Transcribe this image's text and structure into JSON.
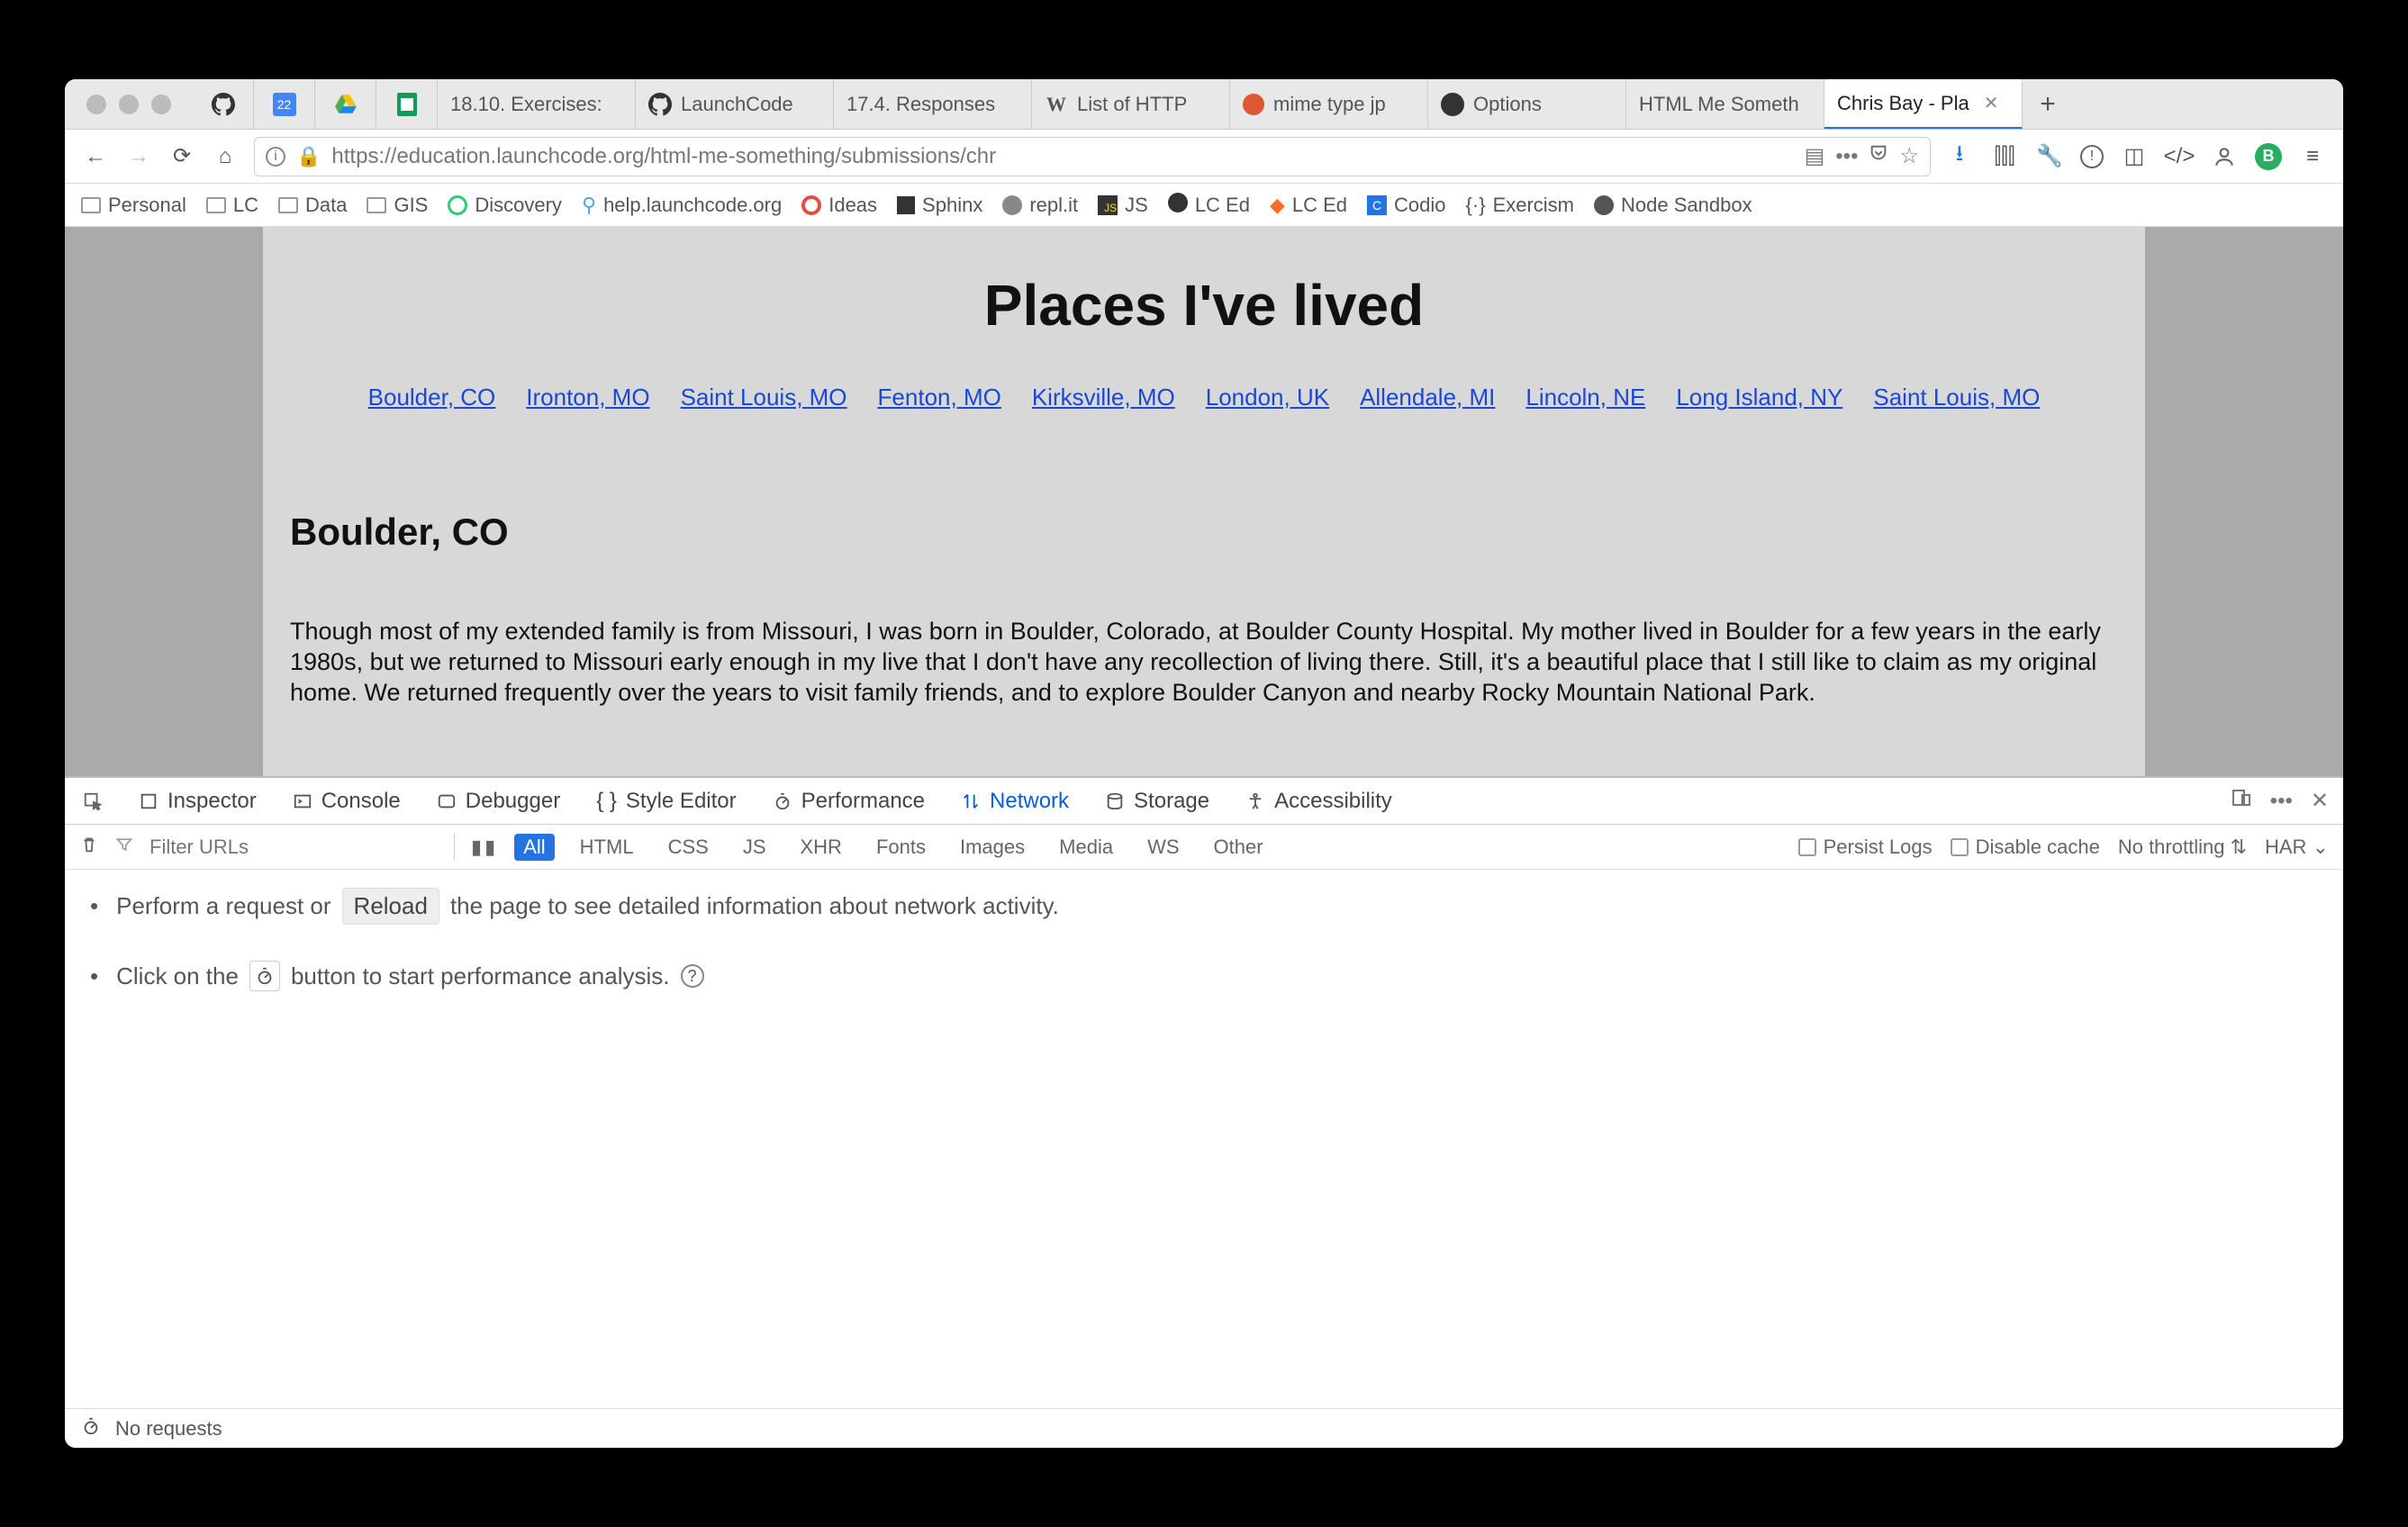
{
  "tabs": [
    {
      "label": "",
      "icon": "github"
    },
    {
      "label": "",
      "icon": "cal22"
    },
    {
      "label": "",
      "icon": "gdrive"
    },
    {
      "label": "",
      "icon": "gsheet"
    },
    {
      "label": "18.10. Exercises:"
    },
    {
      "label": "LaunchCode",
      "icon": "github"
    },
    {
      "label": "17.4. Responses"
    },
    {
      "label": "List of HTTP",
      "icon": "wiki"
    },
    {
      "label": "mime type jp",
      "icon": "ddg"
    },
    {
      "label": "Options",
      "icon": "github"
    },
    {
      "label": "HTML Me Someth"
    },
    {
      "label": "Chris Bay - Pla",
      "active": true
    }
  ],
  "newtab_label": "+",
  "url": "https://education.launchcode.org/html-me-something/submissions/chr",
  "bookmarks": [
    {
      "label": "Personal",
      "type": "folder"
    },
    {
      "label": "LC",
      "type": "folder"
    },
    {
      "label": "Data",
      "type": "folder"
    },
    {
      "label": "GIS",
      "type": "folder"
    },
    {
      "label": "Discovery",
      "icon": "green-circle"
    },
    {
      "label": "help.launchcode.org",
      "icon": "lc-help"
    },
    {
      "label": "Ideas",
      "icon": "red-o"
    },
    {
      "label": "Sphinx",
      "icon": "sphinx"
    },
    {
      "label": "repl.it",
      "icon": "replit"
    },
    {
      "label": "JS",
      "icon": "js"
    },
    {
      "label": "LC Ed",
      "icon": "github"
    },
    {
      "label": "LC Ed",
      "icon": "gitlab"
    },
    {
      "label": "Codio",
      "icon": "codio"
    },
    {
      "label": "Exercism",
      "icon": "exercism"
    },
    {
      "label": "Node Sandbox",
      "icon": "node"
    }
  ],
  "page": {
    "title": "Places I've lived",
    "nav": [
      "Boulder, CO",
      "Ironton, MO",
      "Saint Louis, MO",
      "Fenton, MO",
      "Kirksville, MO",
      "London, UK",
      "Allendale, MI",
      "Lincoln, NE",
      "Long Island, NY",
      "Saint Louis, MO"
    ],
    "section_heading": "Boulder, CO",
    "section_body": "Though most of my extended family is from Missouri, I was born in Boulder, Colorado, at Boulder County Hospital. My mother lived in Boulder for a few years in the early 1980s, but we returned to Missouri early enough in my live that I don't have any recollection of living there. Still, it's a beautiful place that I still like to claim as my original home. We returned frequently over the years to visit family friends, and to explore Boulder Canyon and nearby Rocky Mountain National Park."
  },
  "devtools": {
    "panels": [
      "Inspector",
      "Console",
      "Debugger",
      "Style Editor",
      "Performance",
      "Network",
      "Storage",
      "Accessibility"
    ],
    "active_panel": "Network",
    "filter_placeholder": "Filter URLs",
    "types": [
      "All",
      "HTML",
      "CSS",
      "JS",
      "XHR",
      "Fonts",
      "Images",
      "Media",
      "WS",
      "Other"
    ],
    "active_type": "All",
    "persist_label": "Persist Logs",
    "disable_cache_label": "Disable cache",
    "throttling_label": "No throttling",
    "har_label": "HAR",
    "hint1_pre": "Perform a request or",
    "hint1_btn": "Reload",
    "hint1_post": "the page to see detailed information about network activity.",
    "hint2_pre": "Click on the",
    "hint2_post": "button to start performance analysis.",
    "status": "No requests"
  },
  "profile_badge": "B"
}
